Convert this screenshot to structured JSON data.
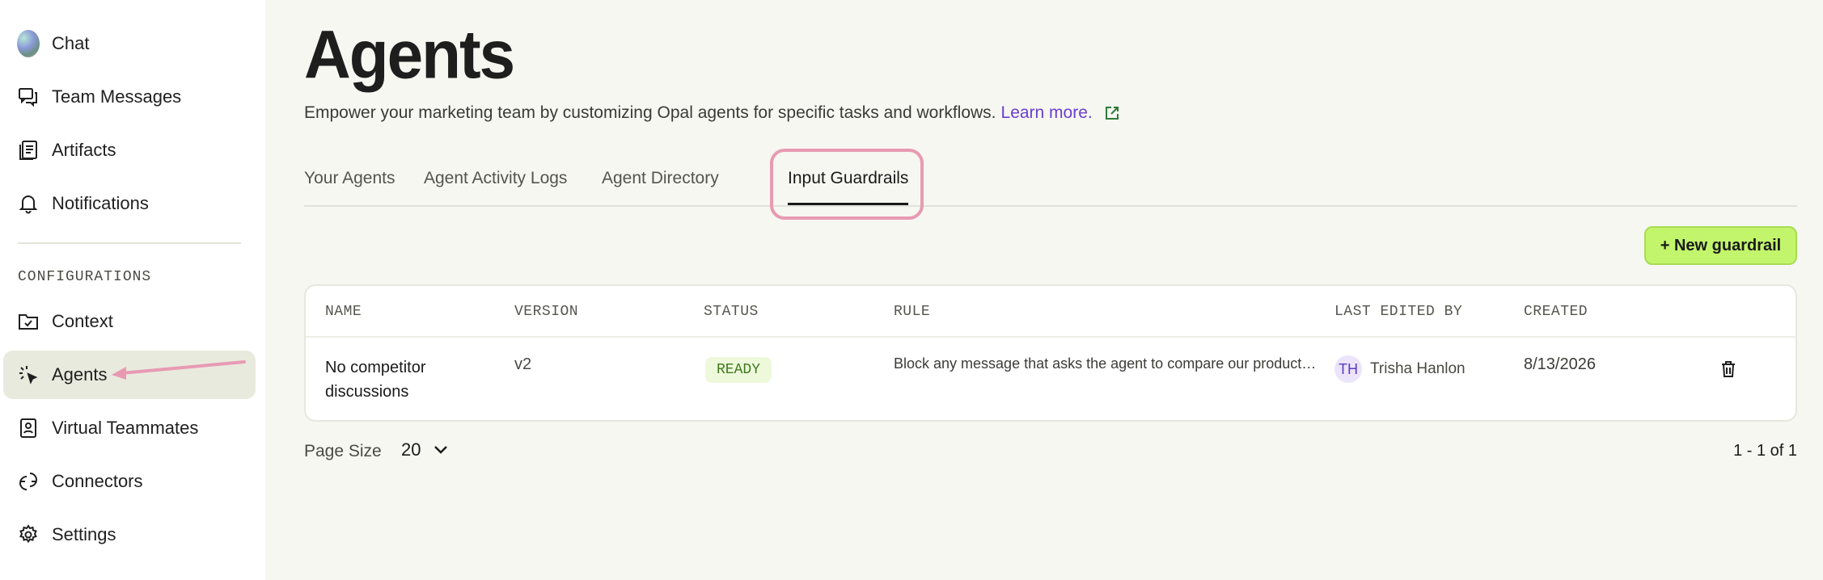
{
  "sidebar": {
    "items_top": [
      {
        "label": "Chat",
        "icon": "chat-avatar-icon"
      },
      {
        "label": "Team Messages",
        "icon": "messages-icon"
      },
      {
        "label": "Artifacts",
        "icon": "artifacts-icon"
      },
      {
        "label": "Notifications",
        "icon": "bell-icon"
      }
    ],
    "section_label": "CONFIGURATIONS",
    "items_config": [
      {
        "label": "Context",
        "icon": "folder-check-icon"
      },
      {
        "label": "Agents",
        "icon": "sparkle-cursor-icon",
        "active": true
      },
      {
        "label": "Virtual Teammates",
        "icon": "contact-card-icon"
      },
      {
        "label": "Connectors",
        "icon": "connector-icon"
      },
      {
        "label": "Settings",
        "icon": "gear-icon"
      }
    ]
  },
  "header": {
    "title": "Agents",
    "subtitle": "Empower your marketing team by customizing Opal agents for specific tasks and workflows.",
    "learn_more": "Learn more."
  },
  "tabs": [
    {
      "label": "Your Agents"
    },
    {
      "label": "Agent Activity Logs"
    },
    {
      "label": "Agent Directory"
    },
    {
      "label": "Input Guardrails",
      "active": true
    }
  ],
  "actions": {
    "new_guardrail": "+ New guardrail"
  },
  "table": {
    "columns": [
      "NAME",
      "VERSION",
      "STATUS",
      "RULE",
      "LAST EDITED BY",
      "CREATED"
    ],
    "rows": [
      {
        "name": "No competitor discussions",
        "version": "v2",
        "status": "READY",
        "rule": "Block any message that asks the agent to compare our products or…",
        "editor_initials": "TH",
        "editor_name": "Trisha Hanlon",
        "created": "8/13/2026"
      }
    ]
  },
  "pagination": {
    "page_size_label": "Page Size",
    "page_size": "20",
    "info": "1 - 1 of 1"
  },
  "colors": {
    "accent_button": "#c2f56c",
    "link": "#6a3ecf",
    "highlight": "#e89ab3",
    "status_ready": "#3f7a1d"
  }
}
